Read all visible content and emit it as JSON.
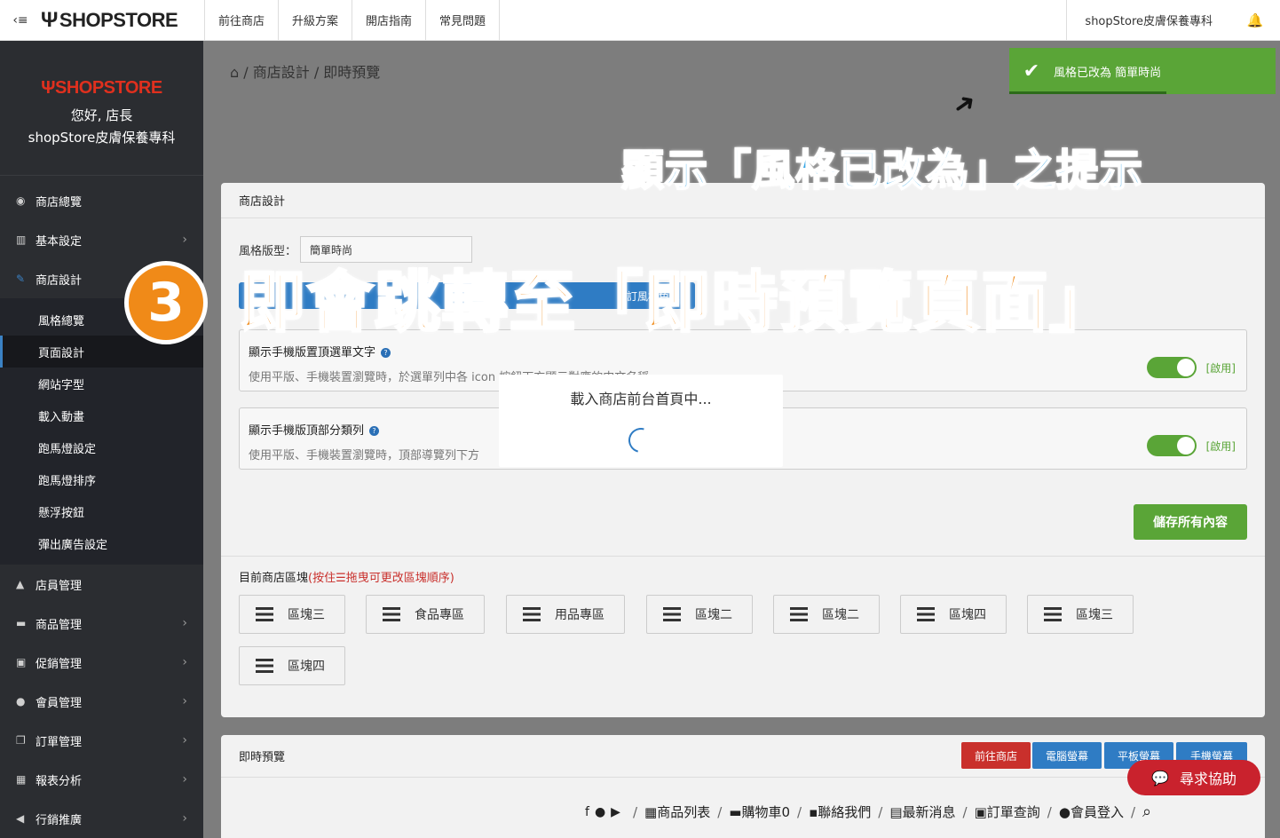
{
  "topbar": {
    "toggle_icon": "‹≡",
    "logo": "SHOPSTORE",
    "nav": [
      "前往商店",
      "升級方案",
      "開店指南",
      "常見問題"
    ],
    "store_name": "shopStore皮膚保養專科"
  },
  "sidebar": {
    "brand": "SHOPSTORE",
    "greeting": "您好, 店長",
    "store_name": "shopStore皮膚保養專科",
    "items": [
      {
        "label": "商店總覽"
      },
      {
        "label": "基本設定"
      },
      {
        "label": "商店設計"
      }
    ],
    "sub_items": [
      "風格總覽",
      "頁面設計",
      "網站字型",
      "載入動畫",
      "跑馬燈設定",
      "跑馬燈排序",
      "懸浮按鈕",
      "彈出廣告設定"
    ],
    "items_after": [
      "店員管理",
      "商品管理",
      "促銷管理",
      "會員管理",
      "訂單管理",
      "報表分析",
      "行銷推廣"
    ]
  },
  "breadcrumb": {
    "home_icon": "⌂",
    "path": "/ 商店設計 / 即時預覽"
  },
  "design_panel": {
    "title": "商店設計",
    "style_label": "風格版型：",
    "style_value": "簡單時尚",
    "custom_color": "自訂風格色系",
    "toggles": [
      {
        "title": "顯示手機版置頂選單文字",
        "desc": "使用平版、手機裝置瀏覽時，於選單列中各 icon 按鈕下方顯示對應的中文名稱。",
        "state": "[啟用]"
      },
      {
        "title": "顯示手機版頂部分類列",
        "desc": "使用平版、手機裝置瀏覽時，頂部導覽列下方",
        "state": "[啟用]"
      }
    ],
    "save_label": "儲存所有內容",
    "blocks_title": "目前商店區塊",
    "blocks_hint": "(按住☰拖曳可更改區塊順序)",
    "blocks": [
      "區塊三",
      "食品專區",
      "用品專區",
      "區塊二",
      "區塊二",
      "區塊四",
      "區塊三",
      "區塊四"
    ]
  },
  "preview_panel": {
    "title": "即時預覽",
    "buttons": [
      "前往商店",
      "電腦螢幕",
      "平板螢幕",
      "手機螢幕"
    ],
    "nav": [
      "商品列表",
      "購物車0",
      "聯絡我們",
      "最新消息",
      "訂單查詢",
      "會員登入"
    ]
  },
  "toast": {
    "text": "風格已改為 簡單時尚"
  },
  "annotations": {
    "top": "顯示「風格已改為」之提示",
    "step": "3",
    "main": "即會跳轉至「即時預覽頁面」"
  },
  "loading": {
    "text": "載入商店前台首頁中..."
  },
  "help": {
    "label": "尋求協助"
  },
  "colors": {
    "sidebar": "#2b2d31",
    "primary": "#2f7cc4",
    "success": "#5aa537",
    "danger": "#c9222d",
    "annotation_orange": "#f08a18",
    "annotation_blue": "#35a6e6"
  }
}
